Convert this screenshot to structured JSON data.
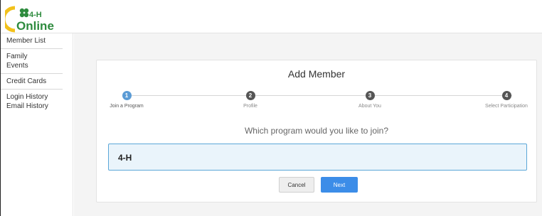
{
  "logo": {
    "clover_text": "4-H",
    "brand": "Online"
  },
  "sidebar": {
    "groups": [
      {
        "items": [
          {
            "label": "Member List"
          }
        ]
      },
      {
        "items": [
          {
            "label": "Family"
          },
          {
            "label": "Events"
          }
        ]
      },
      {
        "items": [
          {
            "label": "Credit Cards"
          }
        ]
      },
      {
        "items": [
          {
            "label": "Login History"
          },
          {
            "label": "Email History"
          }
        ]
      }
    ]
  },
  "card": {
    "title": "Add Member",
    "steps": [
      {
        "number": "1",
        "label": "Join a Program",
        "active": true
      },
      {
        "number": "2",
        "label": "Profile",
        "active": false
      },
      {
        "number": "3",
        "label": "About You",
        "active": false
      },
      {
        "number": "4",
        "label": "Select Participation",
        "active": false
      }
    ],
    "question": "Which program would you like to join?",
    "program_option": "4-H",
    "cancel_label": "Cancel",
    "next_label": "Next"
  },
  "colors": {
    "accent": "#3c8de8",
    "step_active": "#5b9bd5",
    "step_inactive": "#555555",
    "program_bg": "#eaf4fb",
    "program_border": "#5ba7d8",
    "logo_green": "#2e8b3e",
    "logo_yellow": "#f2c11a"
  }
}
